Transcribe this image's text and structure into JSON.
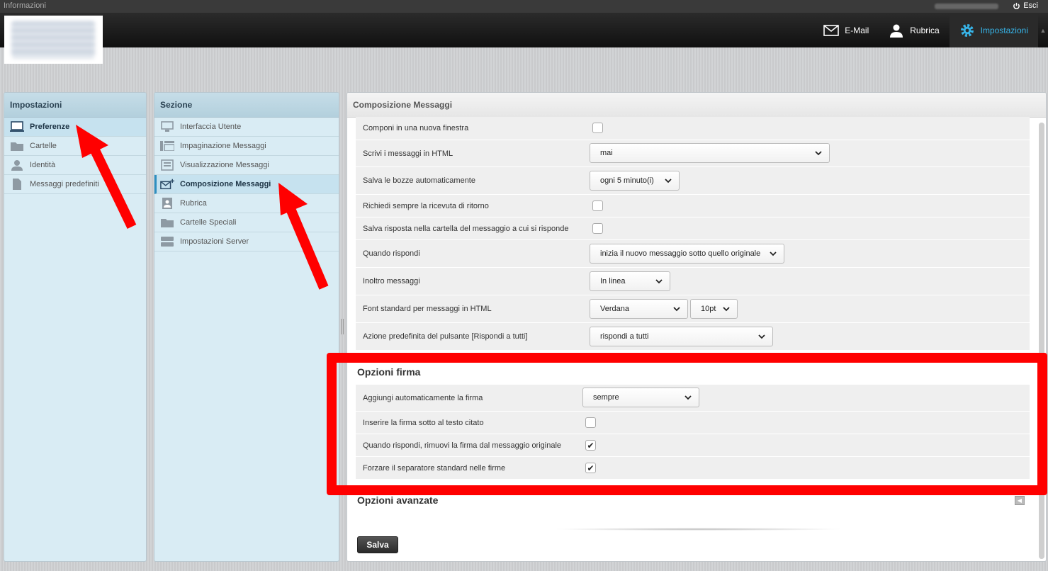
{
  "topbar": {
    "info_label": "Informazioni",
    "logout_label": "Esci"
  },
  "nav": {
    "items": [
      {
        "label": "E-Mail",
        "icon": "envelope-icon"
      },
      {
        "label": "Rubrica",
        "icon": "person-icon"
      },
      {
        "label": "Impostazioni",
        "icon": "gear-icon"
      }
    ],
    "active": "Impostazioni"
  },
  "settings_panel": {
    "title": "Impostazioni",
    "items": [
      "Preferenze",
      "Cartelle",
      "Identità",
      "Messaggi predefiniti"
    ]
  },
  "section_panel": {
    "title": "Sezione",
    "items": [
      "Interfaccia Utente",
      "Impaginazione Messaggi",
      "Visualizzazione Messaggi",
      "Composizione Messaggi",
      "Rubrica",
      "Cartelle Speciali",
      "Impostazioni Server"
    ]
  },
  "main": {
    "title": "Composizione Messaggi",
    "rows": {
      "new_window": {
        "label": "Componi in una nuova finestra",
        "checked": false
      },
      "html": {
        "label": "Scrivi i messaggi in HTML",
        "value": "mai"
      },
      "drafts": {
        "label": "Salva le bozze automaticamente",
        "value": "ogni 5 minuto(i)"
      },
      "receipt": {
        "label": "Richiedi sempre la ricevuta di ritorno",
        "checked": false
      },
      "save_reply": {
        "label": "Salva risposta nella cartella del messaggio a cui si risponde",
        "checked": false
      },
      "reply_mode": {
        "label": "Quando rispondi",
        "value": "inizia il nuovo messaggio sotto quello originale"
      },
      "forward": {
        "label": "Inoltro messaggi",
        "value": "In linea"
      },
      "font": {
        "label": "Font standard per messaggi in HTML",
        "value": "Verdana",
        "size": "10pt"
      },
      "reply_all": {
        "label": "Azione predefinita del pulsante [Rispondi a tutti]",
        "value": "rispondi a tutti"
      }
    },
    "signature": {
      "title": "Opzioni firma",
      "auto": {
        "label": "Aggiungi automaticamente la firma",
        "value": "sempre"
      },
      "below_quote": {
        "label": "Inserire la firma sotto al testo citato",
        "checked": false
      },
      "strip": {
        "label": "Quando rispondi, rimuovi la firma dal messaggio originale",
        "checked": true
      },
      "separator": {
        "label": "Forzare il separatore standard nelle firme",
        "checked": true
      }
    },
    "advanced_title": "Opzioni avanzate",
    "save_label": "Salva"
  },
  "colors": {
    "accent": "#37b4e8",
    "annotation": "#ff0000",
    "panel_bg": "#d9ecf4"
  }
}
